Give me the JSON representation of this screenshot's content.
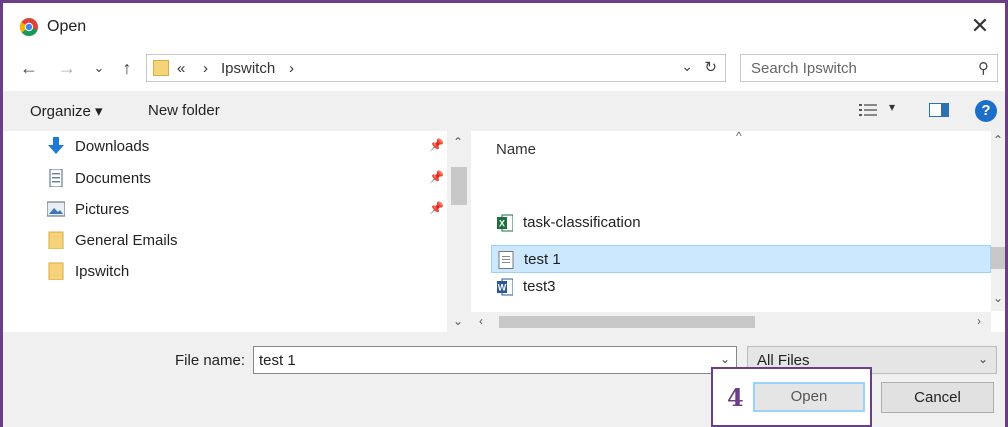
{
  "window": {
    "title": "Open",
    "close_icon": "close-icon"
  },
  "nav": {
    "back_icon": "←",
    "forward_icon": "→",
    "recent_icon": "⌄",
    "up_icon": "↑",
    "breadcrumb_overflow": "«",
    "breadcrumb_sep": "›",
    "breadcrumb_folder": "Ipswitch",
    "breadcrumb_end": "›",
    "dropdown_icon": "⌄",
    "refresh_icon": "↻",
    "search_placeholder": "Search Ipswitch"
  },
  "toolbar": {
    "organize_label": "Organize ▾",
    "new_folder_label": "New folder",
    "view_dropdown": "▾",
    "help_label": "?"
  },
  "sidebar": {
    "items": [
      {
        "label": "Downloads",
        "icon": "download-arrow-icon",
        "pinned": true
      },
      {
        "label": "Documents",
        "icon": "document-icon",
        "pinned": true
      },
      {
        "label": "Pictures",
        "icon": "pictures-icon",
        "pinned": true
      },
      {
        "label": "General Emails",
        "icon": "folder-icon",
        "pinned": false
      },
      {
        "label": "Ipswitch",
        "icon": "folder-icon",
        "pinned": false
      }
    ],
    "pin_glyph": "📌"
  },
  "files": {
    "column_name": "Name",
    "sort_glyph": "^",
    "items": [
      {
        "label": "task-classification",
        "icon": "excel-icon"
      },
      {
        "label": "test 1",
        "icon": "text-file-icon",
        "selected": true
      },
      {
        "label": "test3",
        "icon": "word-icon"
      }
    ]
  },
  "footer": {
    "file_name_label": "File name:",
    "file_name_value": "test 1",
    "file_type": "All Files",
    "open_label": "Open",
    "cancel_label": "Cancel",
    "step_number": "4"
  },
  "colors": {
    "annotation": "#6b3e88",
    "selection": "#cce8ff",
    "accent": "#1b6fc9"
  }
}
